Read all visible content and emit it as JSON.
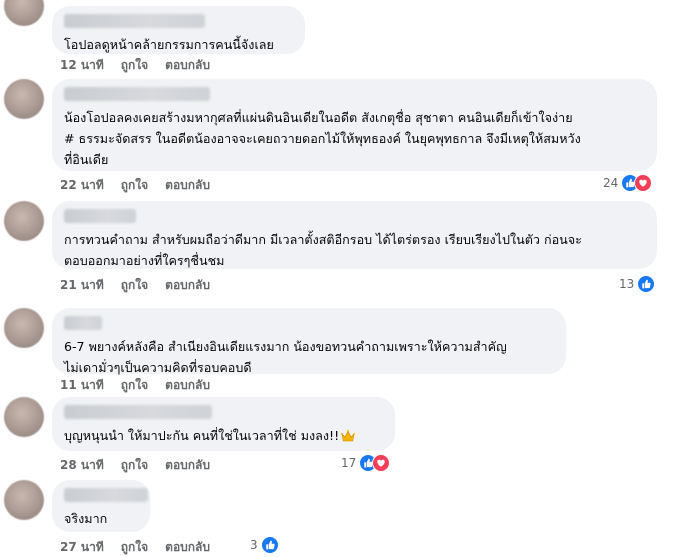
{
  "comments": [
    {
      "text": "โอปอลดูหน้าคล้ายกรรมการคนนี้จังเลย",
      "time": "12 นาที",
      "like": "ถูกใจ",
      "reply": "ตอบกลับ",
      "reaction_count": ""
    },
    {
      "text_lines": [
        "น้องโอปอลคงเคยสร้างมหากุศลที่แผ่นดินอินเดียในอดีต สังเกตุชื่อ สุชาตา คนอินเดียก็เข้าใจง่าย",
        "# ธรรมะจัดสรร ในอดีตน้องอาจจะเคยถวายดอกไม้ให้พุทธองค์ ในยุคพุทธกาล จึงมีเหตุให้สมหวัง",
        "ที่อินเดีย"
      ],
      "time": "22 นาที",
      "like": "ถูกใจ",
      "reply": "ตอบกลับ",
      "reaction_count": "24"
    },
    {
      "text_lines": [
        "การทวนคำถาม สำหรับผมถือว่าดีมาก มีเวลาตั้งสติอีกรอบ ได้ไตร่ตรอง เรียบเรียงไปในตัว ก่อนจะ",
        "ตอบออกมาอย่างที่ใครๆชื่นชม"
      ],
      "time": "21 นาที",
      "like": "ถูกใจ",
      "reply": "ตอบกลับ",
      "reaction_count": "13"
    },
    {
      "text_lines": [
        "6-7 พยางค์หลังคือ สำเนียงอินเดียแรงมาก น้องขอทวนคำถามเพราะให้ความสำคัญ",
        "ไม่เดามั่วๆเป็นความคิดที่รอบคอบดี"
      ],
      "time": "11 นาที",
      "like": "ถูกใจ",
      "reply": "ตอบกลับ",
      "reaction_count": ""
    },
    {
      "text": "บุญหนุนนำ ให้มาปะกัน คนที่ใช่ในเวลาที่ใช่ มงลง!!",
      "time": "28 นาที",
      "like": "ถูกใจ",
      "reply": "ตอบกลับ",
      "reaction_count": "17"
    },
    {
      "text": "จริงมาก",
      "time": "27 นาที",
      "like": "ถูกใจ",
      "reply": "ตอบกลับ",
      "reaction_count": "3"
    }
  ],
  "colors": {
    "bubble": "#f0f2f5",
    "like_blue": "#1877f2",
    "love_red": "#f33e58",
    "meta_gray": "#65676b"
  }
}
